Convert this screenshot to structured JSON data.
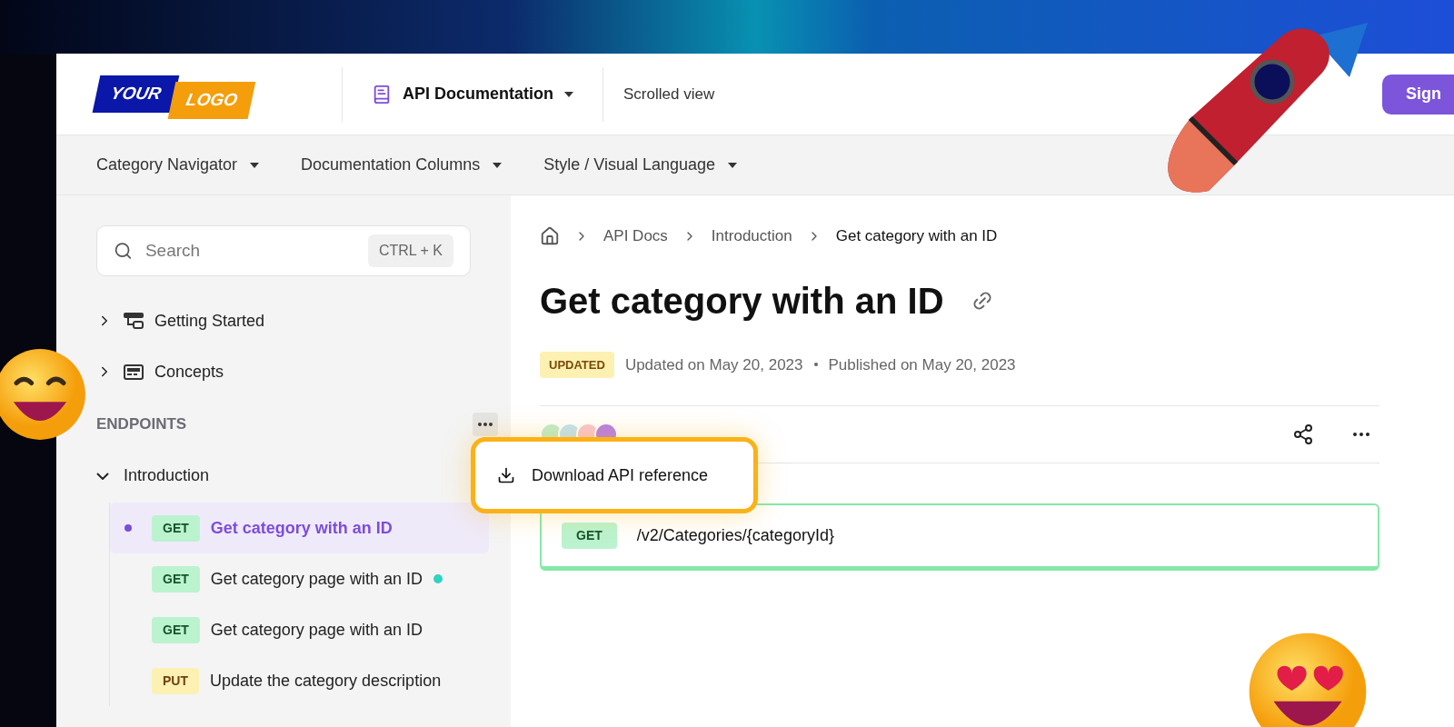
{
  "header": {
    "logo": {
      "word_1": "YOUR",
      "word_2": "LOGO"
    },
    "product": "API Documentation",
    "view": "Scrolled view",
    "sign_button": "Sign"
  },
  "nav": [
    {
      "label": "Category Navigator"
    },
    {
      "label": "Documentation Columns"
    },
    {
      "label": "Style / Visual Language"
    }
  ],
  "sidebar": {
    "search": {
      "placeholder": "Search",
      "shortcut": "CTRL + K"
    },
    "items": [
      {
        "label": "Getting Started",
        "expanded": false,
        "kind": "tree"
      },
      {
        "label": "Concepts",
        "expanded": false,
        "kind": "card"
      }
    ],
    "section": "ENDPOINTS",
    "group": {
      "label": "Introduction",
      "expanded": true,
      "children": [
        {
          "method": "GET",
          "kind": "get",
          "label": "Get category with an ID",
          "selected": true
        },
        {
          "method": "GET",
          "kind": "get",
          "label": "Get category page with an ID",
          "selected": false,
          "color": "#2dd4bf"
        },
        {
          "method": "GET",
          "kind": "get",
          "label": "Get category page with an ID",
          "selected": false
        },
        {
          "method": "PUT",
          "kind": "put",
          "label": "Update the category description",
          "selected": false
        }
      ]
    }
  },
  "content": {
    "breadcrumbs": [
      "API Docs",
      "Introduction",
      "Get category with an ID"
    ],
    "title": "Get category with an ID",
    "status_badge": "UPDATED",
    "updated": "Updated on May 20, 2023",
    "published": "Published on May 20, 2023",
    "menu": {
      "items": [
        {
          "label": "Download API reference"
        }
      ]
    },
    "endpoint": {
      "method": "GET",
      "kind": "get",
      "path": "/v2/Categories/{categoryId}"
    }
  }
}
